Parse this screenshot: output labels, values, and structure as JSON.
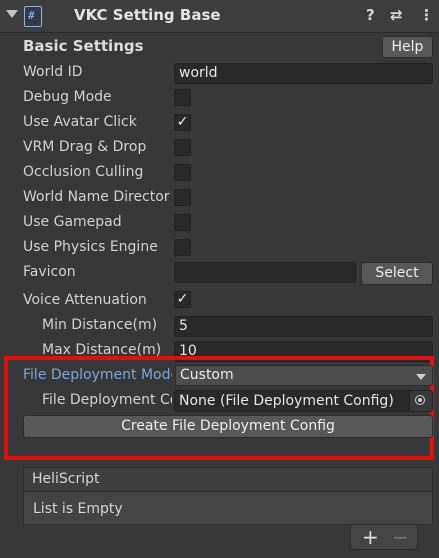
{
  "header": {
    "title": "VKC Setting Base",
    "help_glyph": "?",
    "settings_glyph": "⇄",
    "more_glyph": "⋮"
  },
  "basic_settings": {
    "title": "Basic Settings",
    "help_label": "Help"
  },
  "fields": {
    "world_id_label": "World ID",
    "world_id_value": "world",
    "debug_mode_label": "Debug Mode",
    "debug_mode_checked": false,
    "use_avatar_click_label": "Use Avatar Click",
    "use_avatar_click_checked": true,
    "vrm_drag_drop_label": "VRM Drag & Drop",
    "vrm_drag_drop_checked": false,
    "occlusion_culling_label": "Occlusion Culling",
    "occlusion_culling_checked": false,
    "world_name_director_label": "World Name Director",
    "world_name_director_checked": false,
    "use_gamepad_label": "Use Gamepad",
    "use_gamepad_checked": false,
    "use_physics_engine_label": "Use Physics Engine",
    "use_physics_engine_checked": false,
    "favicon_label": "Favicon",
    "favicon_value": "",
    "select_label": "Select",
    "voice_attenuation_label": "Voice Attenuation",
    "voice_attenuation_checked": true,
    "check_glyph": "✓",
    "min_distance_label": "Min Distance(m)",
    "min_distance_value": "5",
    "max_distance_label": "Max Distance(m)",
    "max_distance_value": "10"
  },
  "deployment": {
    "mode_label": "File Deployment Mode",
    "mode_value": "Custom",
    "config_label": "File Deployment Config",
    "config_value": "None (File Deployment Config)",
    "create_button_label": "Create File Deployment Config"
  },
  "heliscript": {
    "header_label": "HeliScript",
    "empty_text": "List is Empty",
    "add_glyph": "+",
    "remove_glyph": "−"
  },
  "colors": {
    "background": "#383838",
    "highlight": "#e01010",
    "mode_label_accent": "#7ba7e0"
  }
}
